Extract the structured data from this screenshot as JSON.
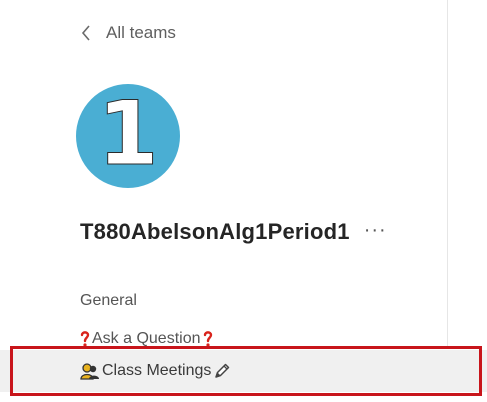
{
  "nav": {
    "back_label": "All teams"
  },
  "team": {
    "avatar_text": "1",
    "name": "T880AbelsonAlg1Period1",
    "more_label": "···",
    "avatar_color": "#4aaed3"
  },
  "channels": [
    {
      "label": "General"
    },
    {
      "label": "Ask a Question"
    },
    {
      "label": "Class Meetings"
    }
  ],
  "icons": {
    "back": "chevron-left-icon",
    "ask_prefix": "red-question-mark-icon",
    "ask_suffix": "red-question-mark-icon",
    "meetings_prefix": "people-icon",
    "meetings_suffix": "pencil-icon"
  },
  "colors": {
    "highlight": "#c8151b",
    "selected_bg": "#f0f0f0"
  }
}
